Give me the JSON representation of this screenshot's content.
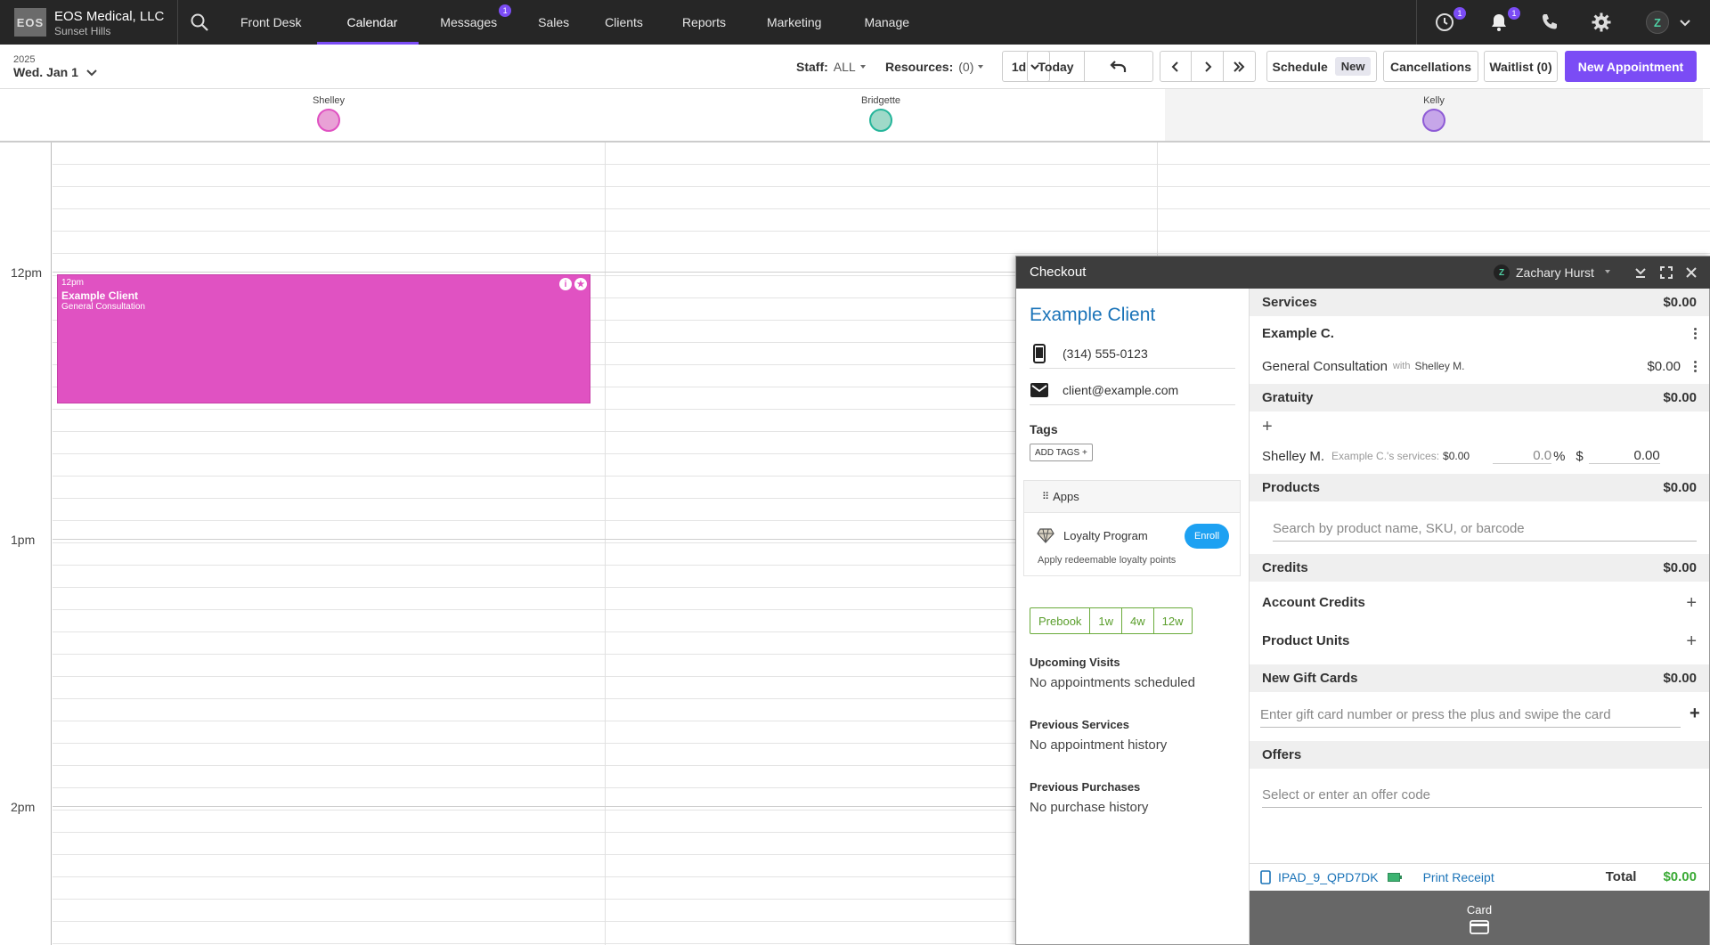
{
  "brand": {
    "logo_text": "EOS",
    "title": "EOS Medical, LLC",
    "subtitle": "Sunset Hills"
  },
  "nav": {
    "items": [
      {
        "label": "Front Desk"
      },
      {
        "label": "Calendar",
        "active": true
      },
      {
        "label": "Messages",
        "badge": "1"
      },
      {
        "label": "Sales"
      },
      {
        "label": "Clients"
      },
      {
        "label": "Reports"
      },
      {
        "label": "Marketing"
      },
      {
        "label": "Manage"
      }
    ],
    "clock_badge": "1",
    "bell_badge": "1",
    "avatar_letter": "Z",
    "accent": "#7b4cf5"
  },
  "toolbar": {
    "year": "2025",
    "date": "Wed. Jan 1",
    "staff_label": "Staff:",
    "staff_value": "ALL",
    "resources_label": "Resources:",
    "resources_value": "(0)",
    "view": "1d",
    "today": "Today",
    "schedule": "Schedule",
    "schedule_pill": "New",
    "cancellations": "Cancellations",
    "waitlist": "Waitlist (0)",
    "new_appointment": "New Appointment"
  },
  "staff": [
    {
      "name": "Shelley",
      "color": "#e052c2"
    },
    {
      "name": "Bridgette",
      "color": "#25b59a"
    },
    {
      "name": "Kelly",
      "color": "#8e5bd6"
    }
  ],
  "times": {
    "t12": "12pm",
    "t1": "1pm",
    "t2": "2pm"
  },
  "appointment": {
    "time": "12pm",
    "client": "Example Client",
    "service": "General Consultation",
    "color": "#e052c2"
  },
  "checkout": {
    "title": "Checkout",
    "user": "Zachary Hurst",
    "user_letter": "Z",
    "client_name": "Example Client",
    "phone": "(314) 555-0123",
    "email": "client@example.com",
    "tags_label": "Tags",
    "add_tags": "ADD TAGS +",
    "apps_label": "Apps",
    "loyalty_name": "Loyalty Program",
    "enroll": "Enroll",
    "loyalty_sub": "Apply redeemable loyalty points",
    "prebook": [
      "Prebook",
      "1w",
      "4w",
      "12w"
    ],
    "upcoming_label": "Upcoming Visits",
    "upcoming_val": "No appointments scheduled",
    "prev_services_label": "Previous Services",
    "prev_services_val": "No appointment history",
    "prev_purchases_label": "Previous Purchases",
    "prev_purchases_val": "No purchase history",
    "services_label": "Services",
    "services_total": "$0.00",
    "example_c": "Example C.",
    "service_name": "General Consultation",
    "service_with": "with",
    "service_staff": "Shelley M.",
    "service_price": "$0.00",
    "gratuity_label": "Gratuity",
    "gratuity_total": "$0.00",
    "grat_staff": "Shelley M.",
    "grat_services_label": "Example C.'s services:",
    "grat_services_val": "$0.00",
    "grat_pct": "0.0",
    "grat_pct_sign": "%",
    "grat_dollar_sign": "$",
    "grat_amount": "0.00",
    "products_label": "Products",
    "products_total": "$0.00",
    "product_search_placeholder": "Search by product name, SKU, or barcode",
    "credits_label": "Credits",
    "credits_total": "$0.00",
    "account_credits": "Account Credits",
    "product_units": "Product Units",
    "gift_cards_label": "New Gift Cards",
    "gift_cards_total": "$0.00",
    "gift_card_placeholder": "Enter gift card number or press the plus and swipe the card",
    "offers_label": "Offers",
    "offer_placeholder": "Select or enter an offer code",
    "device": "IPAD_9_QPD7DK",
    "print_receipt": "Print Receipt",
    "total_label": "Total",
    "total_value": "$0.00",
    "card_label": "Card"
  }
}
